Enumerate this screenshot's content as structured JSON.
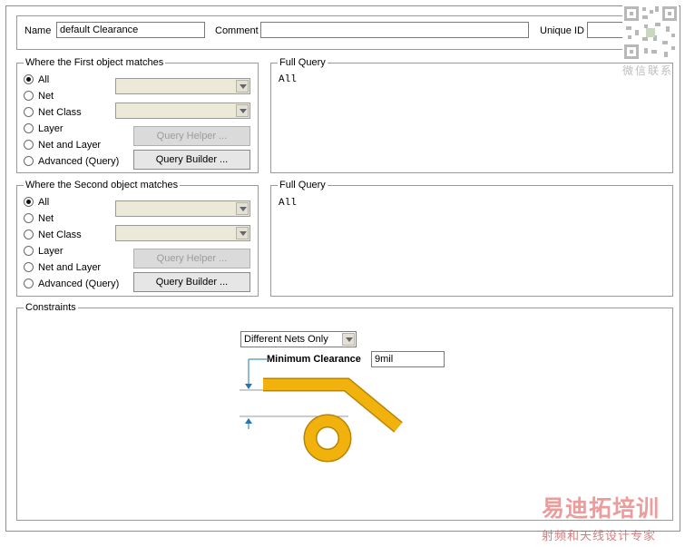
{
  "header": {
    "name_label": "Name",
    "name_value": "default Clearance",
    "comment_label": "Comment",
    "comment_value": "",
    "unique_id_label": "Unique ID",
    "unique_id_value": ""
  },
  "first": {
    "title": "Where the First object matches",
    "options": [
      "All",
      "Net",
      "Net Class",
      "Layer",
      "Net and Layer",
      "Advanced (Query)"
    ],
    "selected_index": 0,
    "query_helper_label": "Query Helper ...",
    "query_builder_label": "Query Builder ...",
    "full_query_title": "Full Query",
    "full_query_text": "All"
  },
  "second": {
    "title": "Where the Second object matches",
    "options": [
      "All",
      "Net",
      "Net Class",
      "Layer",
      "Net and Layer",
      "Advanced (Query)"
    ],
    "selected_index": 0,
    "query_helper_label": "Query Helper ...",
    "query_builder_label": "Query Builder ...",
    "full_query_title": "Full Query",
    "full_query_text": "All"
  },
  "constraints": {
    "title": "Constraints",
    "net_scope": "Different Nets Only",
    "min_clearance_label": "Minimum Clearance",
    "min_clearance_value": "9mil"
  },
  "watermark": {
    "wechat_label": "微信联系",
    "brand_main": "易迪拓培训",
    "brand_sub": "射频和天线设计专家"
  },
  "colors": {
    "copper": "#f2b20e",
    "copper_edge": "#b98400",
    "dimension": "#1f77b4",
    "brand_red": "#e04a4a"
  }
}
